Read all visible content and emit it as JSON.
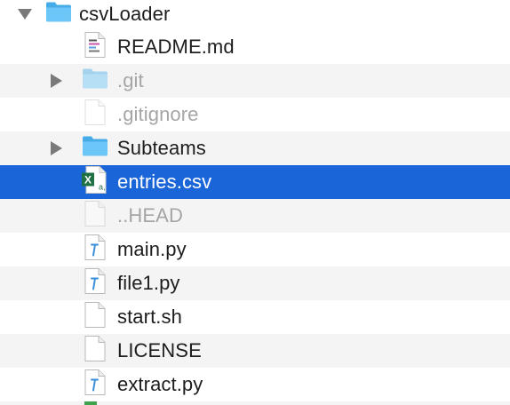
{
  "tree": {
    "root": {
      "name": "csvLoader",
      "icon": "folder-icon",
      "expanded": true
    },
    "items": [
      {
        "name": "README.md",
        "icon": "markdown-file-icon",
        "dimmed": false,
        "selected": false,
        "expandable": false
      },
      {
        "name": ".git",
        "icon": "folder-icon",
        "dimmed": true,
        "selected": false,
        "expandable": true
      },
      {
        "name": ".gitignore",
        "icon": "file-icon",
        "dimmed": true,
        "selected": false,
        "expandable": false
      },
      {
        "name": "Subteams",
        "icon": "folder-icon",
        "dimmed": false,
        "selected": false,
        "expandable": true
      },
      {
        "name": "entries.csv",
        "icon": "excel-csv-file-icon",
        "dimmed": false,
        "selected": true,
        "expandable": false
      },
      {
        "name": "..HEAD",
        "icon": "file-icon",
        "dimmed": true,
        "selected": false,
        "expandable": false
      },
      {
        "name": "main.py",
        "icon": "python-file-icon",
        "dimmed": false,
        "selected": false,
        "expandable": false
      },
      {
        "name": "file1.py",
        "icon": "python-file-icon",
        "dimmed": false,
        "selected": false,
        "expandable": false
      },
      {
        "name": "start.sh",
        "icon": "file-icon",
        "dimmed": false,
        "selected": false,
        "expandable": false
      },
      {
        "name": "LICENSE",
        "icon": "file-icon",
        "dimmed": false,
        "selected": false,
        "expandable": false
      },
      {
        "name": "extract.py",
        "icon": "python-file-icon",
        "dimmed": false,
        "selected": false,
        "expandable": false
      }
    ]
  },
  "colors": {
    "selection": "#1a66d8",
    "folder": "#5fbff5",
    "excel": "#1e7145",
    "python_accent": "#3a8fd8",
    "dimmed_text": "#a5a5a5"
  }
}
